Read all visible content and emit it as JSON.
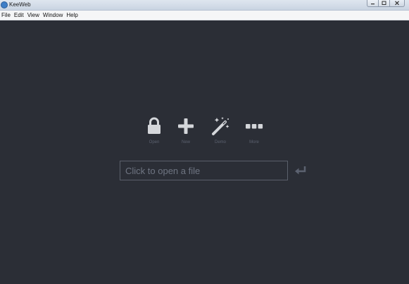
{
  "window": {
    "title": "KeeWeb",
    "controls": [
      "minimize",
      "maximize",
      "close"
    ]
  },
  "menubar": {
    "items": [
      "File",
      "Edit",
      "View",
      "Window",
      "Help"
    ]
  },
  "actions": [
    {
      "label": "Open",
      "icon": "lock-icon"
    },
    {
      "label": "New",
      "icon": "plus-icon"
    },
    {
      "label": "Demo",
      "icon": "magic-wand-icon"
    },
    {
      "label": "More",
      "icon": "more-icon"
    }
  ],
  "open_file": {
    "placeholder": "Click to open a file",
    "submit_icon": "enter-icon"
  },
  "colors": {
    "background": "#2b2e36",
    "icon": "#d4d6da",
    "label": "#5c6270",
    "input_border": "#5b606b"
  }
}
